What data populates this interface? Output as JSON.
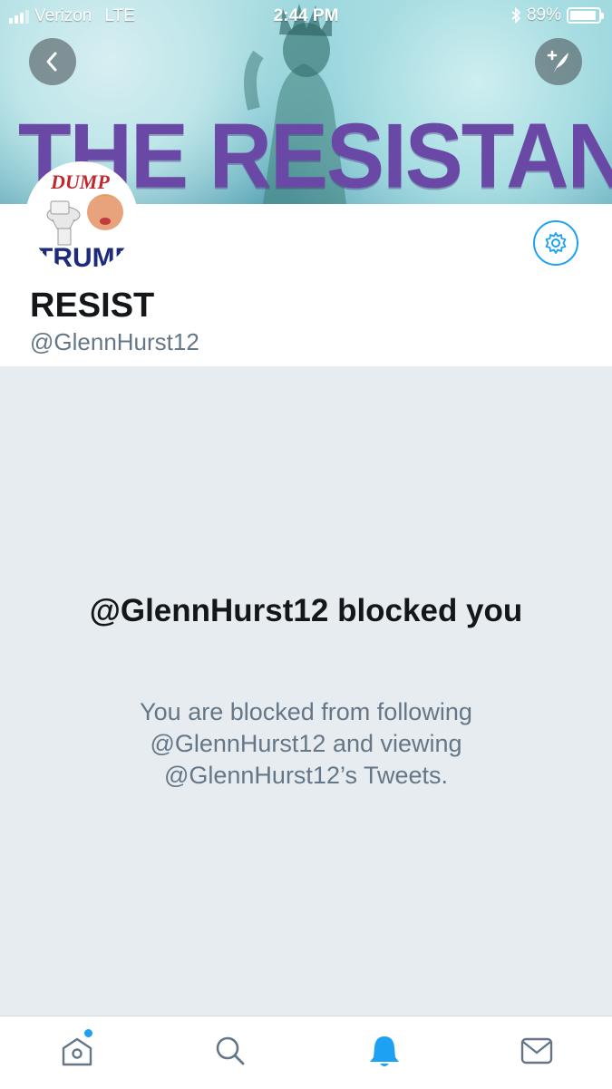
{
  "status_bar": {
    "carrier": "Verizon",
    "network": "LTE",
    "time": "2:44 PM",
    "battery": "89%",
    "battery_level": 0.89
  },
  "header": {
    "banner_text": "THE RESISTANCE",
    "back_icon": "chevron-left-icon",
    "compose_icon": "compose-tweet-icon"
  },
  "avatar": {
    "text_top": "DUMP",
    "text_bottom": "TRUMP"
  },
  "profile": {
    "name": "RESIST",
    "handle": "@GlennHurst12",
    "settings_icon": "gear-icon"
  },
  "blocked": {
    "title": "@GlennHurst12 blocked you",
    "description": "You are blocked from following @GlennHurst12 and viewing @GlennHurst12’s Tweets."
  },
  "tabbar": {
    "items": [
      {
        "icon": "home-icon",
        "active": false,
        "badge": true
      },
      {
        "icon": "search-icon",
        "active": false,
        "badge": false
      },
      {
        "icon": "notifications-icon",
        "active": true,
        "badge": false
      },
      {
        "icon": "messages-icon",
        "active": false,
        "badge": false
      }
    ]
  },
  "colors": {
    "accent": "#1da1f2",
    "banner_text": "#6a49a6",
    "background": "#e6ecf0",
    "muted_text": "#657786",
    "primary_text": "#14171a"
  }
}
